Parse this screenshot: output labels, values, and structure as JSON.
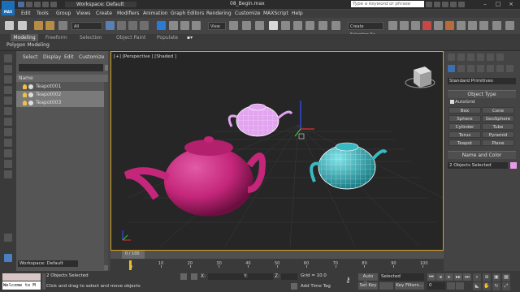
{
  "app": {
    "logo_text": "MAX",
    "workspace": "Workspace: Default",
    "file_title": "08_Begin.max",
    "search_placeholder": "Type a keyword or phrase"
  },
  "menu": [
    "Edit",
    "Tools",
    "Group",
    "Views",
    "Create",
    "Modifiers",
    "Animation",
    "Graph Editors",
    "Rendering",
    "Customize",
    "MAXScript",
    "Help"
  ],
  "toolbar": {
    "filter_value": "All",
    "refcoord_value": "View",
    "selection_set_placeholder": "Create Selection Se..."
  },
  "ribbon": {
    "tabs": [
      "Modeling",
      "Freeform",
      "Selection",
      "Object Paint",
      "Populate"
    ],
    "sub_label": "Polygon Modeling"
  },
  "scene_explorer": {
    "menu": [
      "Select",
      "Display",
      "Edit",
      "Customize"
    ],
    "column_header": "Name",
    "items": [
      {
        "name": "Teapot001",
        "selected": false
      },
      {
        "name": "Teapot002",
        "selected": true
      },
      {
        "name": "Teapot003",
        "selected": true
      }
    ],
    "workspace": "Workspace: Default"
  },
  "viewport": {
    "label": "[+] [Perspective ] [Shaded ]"
  },
  "command_panel": {
    "category": "Standard Primitives",
    "object_type_header": "Object Type",
    "autogrid_label": "AutoGrid",
    "buttons": [
      "Box",
      "Cone",
      "Sphere",
      "GeoSphere",
      "Cylinder",
      "Tube",
      "Torus",
      "Pyramid",
      "Teapot",
      "Plane"
    ],
    "name_color_header": "Name and Color",
    "selection_name": "2 Objects Selected",
    "color": "#e89be8"
  },
  "timeline": {
    "frame_label": "0 / 100",
    "ticks": [
      "0",
      "10",
      "20",
      "30",
      "40",
      "50",
      "60",
      "70",
      "80",
      "90",
      "100"
    ]
  },
  "status": {
    "maxscript_text": "Welcome to M",
    "selection_status": "2 Objects Selected",
    "prompt": "Click and drag to select and move objects",
    "x_label": "X:",
    "y_label": "Y:",
    "z_label": "Z:",
    "grid": "Grid = 10.0",
    "add_time_tag": "Add Time Tag",
    "auto_key": "Auto Key",
    "set_key": "Set Key",
    "key_mode": "Selected",
    "key_filters": "Key Filters...",
    "frame_value": "0"
  },
  "colors": {
    "teapot_magenta": "#c4267a",
    "teapot_cyan": "#3ab9c2",
    "teapot_pink": "#e3a4ef",
    "viewport_border": "#d6a11e"
  }
}
